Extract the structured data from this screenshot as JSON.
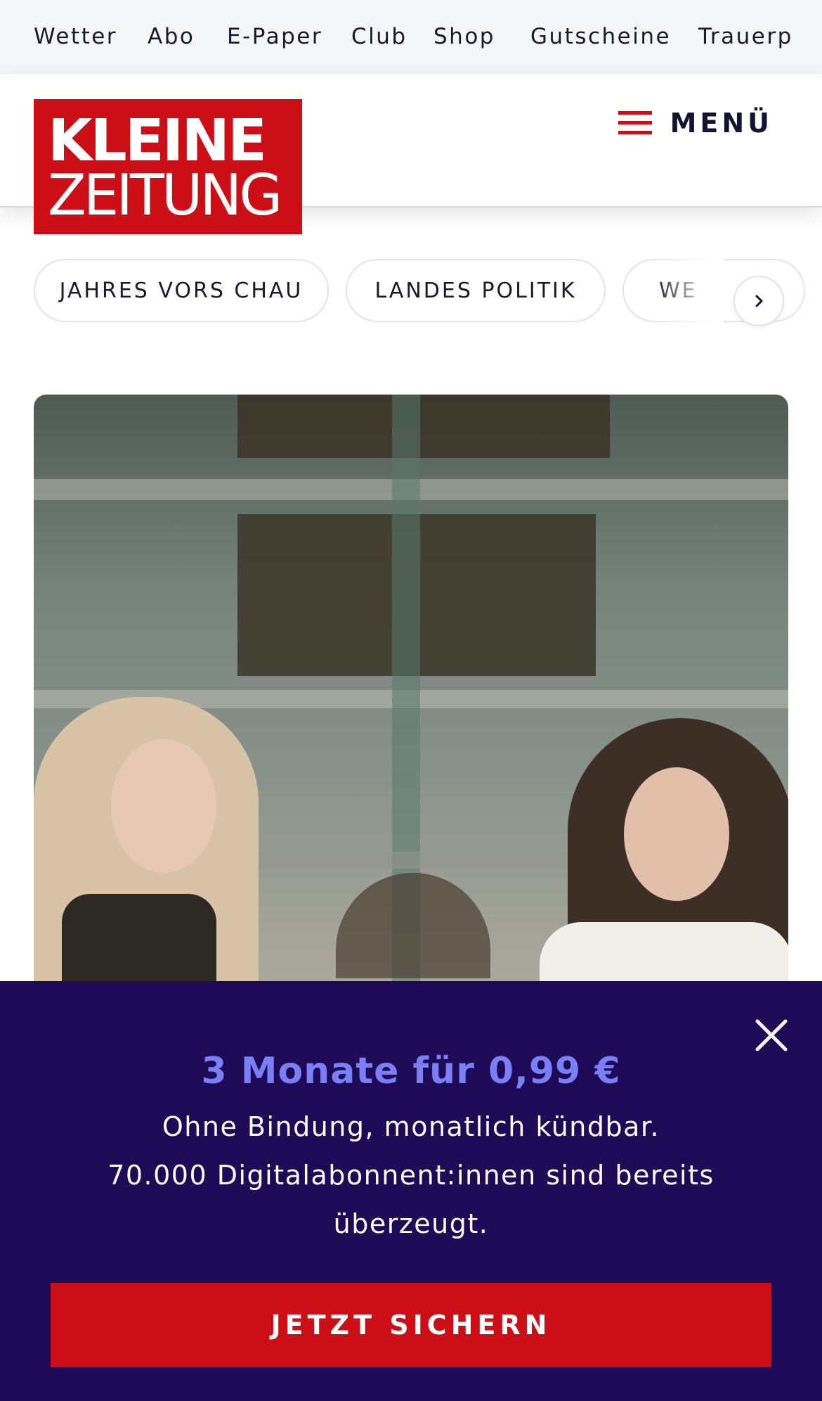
{
  "utility_nav": {
    "items": [
      "Wetter",
      "Abo",
      "E-Paper",
      "Club",
      "Shop",
      "Gutscheine",
      "Trauerp"
    ]
  },
  "header": {
    "logo_line1": "KLEINE",
    "logo_line2": "ZEITUNG",
    "menu_label": "MENÜ"
  },
  "topics": {
    "chips": [
      "JAHRES VORS CHAU",
      "LANDES POLITIK",
      "WE"
    ]
  },
  "promo": {
    "headline": "3 Monate für 0,99 €",
    "line1": "Ohne Bindung, monatlich kündbar.",
    "line2": "70.000 Digitalabonnent:innen sind bereits",
    "line3": "überzeugt.",
    "cta": "JETZT SICHERN"
  },
  "colors": {
    "brand_red": "#cc0f17",
    "promo_bg": "#1e0a56",
    "promo_accent": "#7b7ff5"
  }
}
